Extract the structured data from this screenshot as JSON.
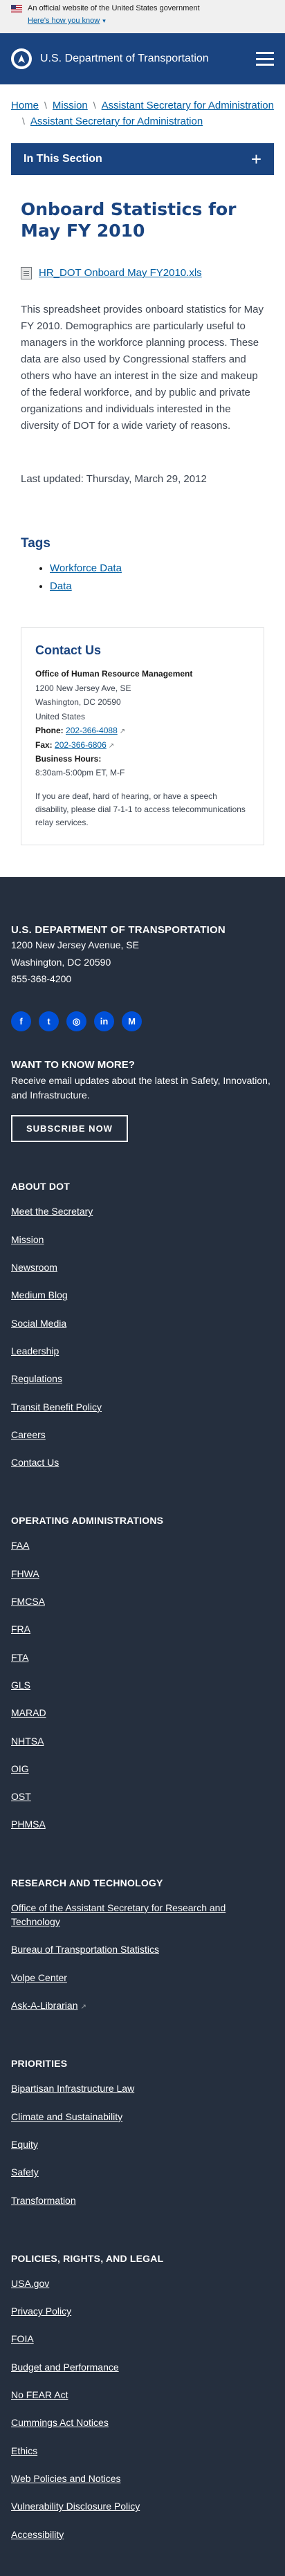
{
  "gov_banner": {
    "text": "An official website of the United States government",
    "how_link": "Here's how you know"
  },
  "header": {
    "title": "U.S. Department of Transportation"
  },
  "breadcrumb": {
    "items": [
      "Home",
      "Mission",
      "Assistant Secretary for Administration",
      "Assistant Secretary for Administration"
    ]
  },
  "section_nav": {
    "label": "In This Section",
    "toggle_icon": "+"
  },
  "page": {
    "title": "Onboard Statistics for May FY 2010",
    "file_link": "HR_DOT Onboard May FY2010.xls",
    "body": "This spreadsheet provides onboard statistics for May FY 2010. Demographics are particularly useful to managers in the workforce planning process. These data are also used by Congressional staffers and others who have an interest in the size and makeup of the federal workforce, and by public and private organizations and individuals interested in the diversity of DOT for a wide variety of reasons.",
    "last_updated": "Last updated: Thursday, March 29, 2012"
  },
  "tags": {
    "title": "Tags",
    "items": [
      "Workforce Data",
      "Data"
    ]
  },
  "contact": {
    "title": "Contact Us",
    "office": "Office of Human Resource Management",
    "address1": "1200 New Jersey Ave, SE",
    "address2": "Washington, DC 20590",
    "country": "United States",
    "phone_label": "Phone:",
    "phone": "202-366-4088",
    "fax_label": "Fax:",
    "fax": "202-366-6806",
    "hours_label": "Business Hours:",
    "hours": "8:30am-5:00pm ET, M-F",
    "note": "If you are deaf, hard of hearing, or have a speech disability, please dial 7-1-1 to access telecommunications relay services."
  },
  "footer": {
    "org": "U.S. DEPARTMENT OF TRANSPORTATION",
    "address1": "1200 New Jersey Avenue, SE",
    "address2": "Washington, DC 20590",
    "phone": "855-368-4200",
    "social": [
      {
        "icon": "facebook-icon",
        "glyph": "f"
      },
      {
        "icon": "twitter-icon",
        "glyph": "t"
      },
      {
        "icon": "instagram-icon",
        "glyph": "◎"
      },
      {
        "icon": "linkedin-icon",
        "glyph": "in"
      },
      {
        "icon": "medium-icon",
        "glyph": "M"
      }
    ],
    "want_title": "WANT TO KNOW MORE?",
    "want_desc": "Receive email updates about the latest in Safety, Innovation, and Infrastructure.",
    "subscribe": "SUBSCRIBE NOW",
    "sections": [
      {
        "title": "ABOUT DOT",
        "links": [
          "Meet the Secretary",
          "Mission",
          "Newsroom",
          "Medium Blog",
          "Social Media",
          "Leadership",
          "Regulations",
          "Transit Benefit Policy",
          "Careers",
          "Contact Us"
        ]
      },
      {
        "title": "OPERATING ADMINISTRATIONS",
        "links": [
          "FAA",
          "FHWA",
          "FMCSA",
          "FRA",
          "FTA",
          "GLS",
          "MARAD",
          "NHTSA",
          "OIG",
          "OST",
          "PHMSA"
        ]
      },
      {
        "title": "RESEARCH AND TECHNOLOGY",
        "links": [
          "Office of the Assistant Secretary for Research and Technology",
          "Bureau of Transportation Statistics",
          "Volpe Center",
          "Ask-A-Librarian"
        ]
      },
      {
        "title": "PRIORITIES",
        "links": [
          "Bipartisan Infrastructure Law",
          "Climate and Sustainability",
          "Equity",
          "Safety",
          "Transformation"
        ]
      },
      {
        "title": "POLICIES, RIGHTS, AND LEGAL",
        "links": [
          "USA.gov",
          "Privacy Policy",
          "FOIA",
          "Budget and Performance",
          "No FEAR Act",
          "Cummings Act Notices",
          "Ethics",
          "Web Policies and Notices",
          "Vulnerability Disclosure Policy",
          "Accessibility"
        ]
      }
    ]
  },
  "colors": {
    "header_blue": "#1a4480",
    "link_blue": "#005ea2",
    "footer_bg": "#252f3e",
    "social_blue": "#0050d8"
  }
}
